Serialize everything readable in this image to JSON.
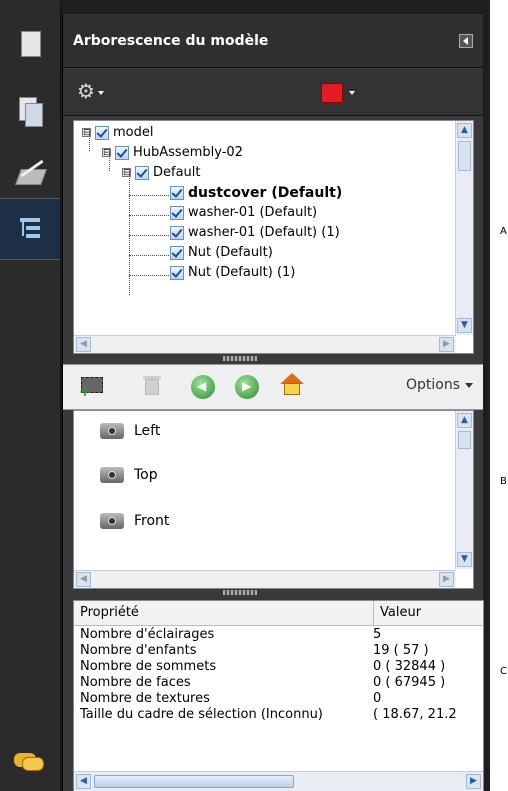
{
  "panel": {
    "title": "Arborescence du modèle"
  },
  "toolbar_colors": {
    "accent": "#e31b23"
  },
  "tree": {
    "items": [
      {
        "label": "model",
        "level": 0,
        "expander": "⊟"
      },
      {
        "label": "HubAssembly-02",
        "level": 1,
        "expander": "⊟"
      },
      {
        "label": "Default",
        "level": 2,
        "expander": "⊟"
      },
      {
        "label": "dustcover (Default)",
        "level": 3,
        "bold": true
      },
      {
        "label": "washer-01 (Default)",
        "level": 3
      },
      {
        "label": "washer-01 (Default) (1)",
        "level": 3
      },
      {
        "label": "Nut (Default)",
        "level": 3
      },
      {
        "label": "Nut (Default) (1)",
        "level": 3
      }
    ]
  },
  "views_toolbar": {
    "options_label": "Options"
  },
  "views": {
    "items": [
      "Left",
      "Top",
      "Front"
    ]
  },
  "properties": {
    "header": {
      "name": "Propriété",
      "value": "Valeur"
    },
    "rows": [
      {
        "name": "Nombre d'éclairages",
        "value": "5"
      },
      {
        "name": "Nombre d'enfants",
        "value": "19 ( 57 )"
      },
      {
        "name": "Nombre de sommets",
        "value": "0 ( 32844 )"
      },
      {
        "name": "Nombre de faces",
        "value": "0 ( 67945 )"
      },
      {
        "name": "Nombre de textures",
        "value": "0"
      },
      {
        "name": "Taille du cadre de sélection (Inconnu)",
        "value": "( 18.67, 21.2"
      }
    ]
  },
  "side_labels": {
    "a": "A",
    "b": "B",
    "c": "C"
  }
}
